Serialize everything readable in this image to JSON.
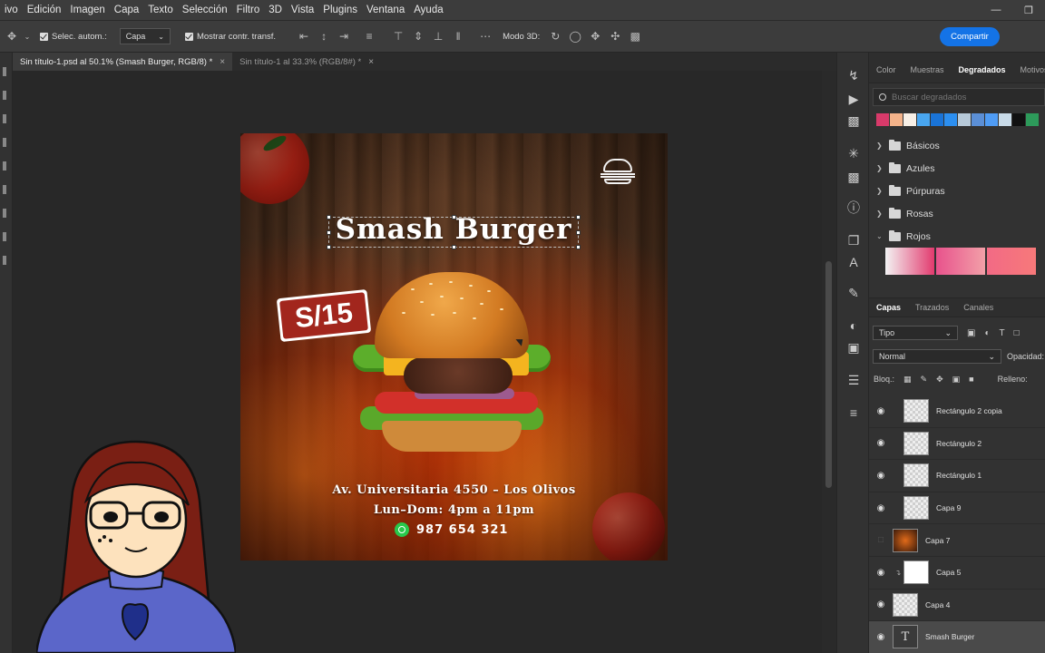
{
  "menu": {
    "items": [
      "ivo",
      "Edición",
      "Imagen",
      "Capa",
      "Texto",
      "Selección",
      "Filtro",
      "3D",
      "Vista",
      "Plugins",
      "Ventana",
      "Ayuda"
    ]
  },
  "options_bar": {
    "auto_select_label": "Selec. autom.:",
    "auto_select_value": "Capa",
    "transform_label": "Mostrar contr. transf.",
    "mode_3d_label": "Modo 3D:",
    "share_label": "Compartir"
  },
  "tabs": [
    {
      "label": "Sin título-1.psd al 50.1% (Smash Burger, RGB/8) *",
      "active": true
    },
    {
      "label": "Sin título-1 al 33.3% (RGB/8#) *",
      "active": false
    }
  ],
  "poster": {
    "title": "Smash Burger",
    "price": "S/15",
    "address": "Av. Universitaria 4550 – Los Olivos",
    "hours": "Lun–Dom: 4pm a 11pm",
    "phone": "987 654 321"
  },
  "gradients_panel": {
    "tabs": [
      "Color",
      "Muestras",
      "Degradados",
      "Motivos"
    ],
    "active_tab": "Degradados",
    "search_placeholder": "Buscar degradados",
    "swatch_colors": [
      "#d83a6a",
      "#f4b38a",
      "#f7efe6",
      "#49a6f0",
      "#1a74d8",
      "#2c8ff0",
      "#b7c9d8",
      "#5b8fd6",
      "#4f9cf5",
      "#c9dbe8",
      "#111111",
      "#2d9a5a"
    ],
    "folders": [
      {
        "label": "Básicos",
        "expanded": false
      },
      {
        "label": "Azules",
        "expanded": false
      },
      {
        "label": "Púrpuras",
        "expanded": false
      },
      {
        "label": "Rosas",
        "expanded": false
      },
      {
        "label": "Rojos",
        "expanded": true
      }
    ]
  },
  "layers_panel": {
    "tabs": [
      "Capas",
      "Trazados",
      "Canales"
    ],
    "active_tab": "Capas",
    "filter_value": "Tipo",
    "blend_mode": "Normal",
    "opacity_label": "Opacidad:",
    "lock_label": "Bloq.:",
    "fill_label": "Relleno:",
    "layers": [
      {
        "name": "Rectángulo 2 copia",
        "visible": true,
        "selected": false
      },
      {
        "name": "Rectángulo 2",
        "visible": true,
        "selected": false
      },
      {
        "name": "Rectángulo 1",
        "visible": true,
        "selected": false
      },
      {
        "name": "Capa 9",
        "visible": true,
        "selected": false
      },
      {
        "name": "Capa 7",
        "visible": false,
        "selected": false
      },
      {
        "name": "Capa 5",
        "visible": true,
        "selected": false
      },
      {
        "name": "Capa 4",
        "visible": true,
        "selected": false
      },
      {
        "name": "Smash Burger",
        "visible": true,
        "selected": true
      }
    ]
  }
}
